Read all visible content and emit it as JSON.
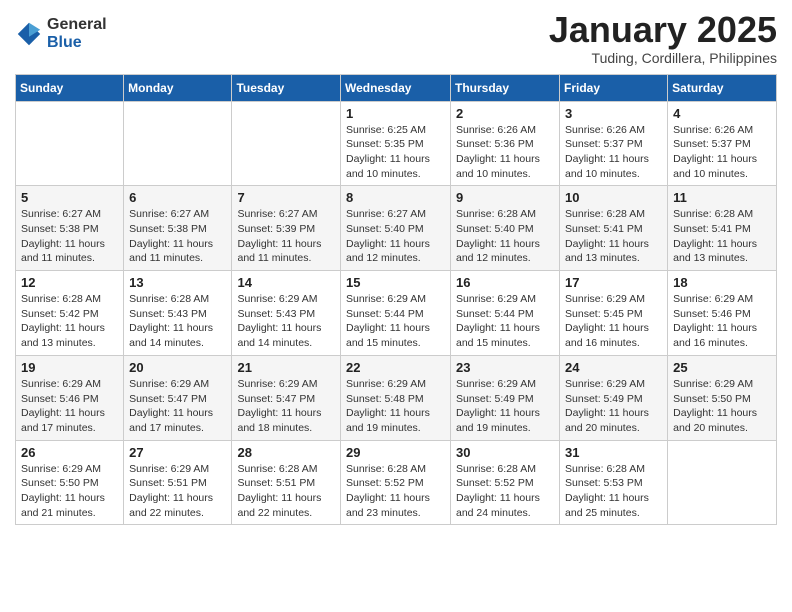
{
  "logo": {
    "general": "General",
    "blue": "Blue"
  },
  "title": {
    "month": "January 2025",
    "location": "Tuding, Cordillera, Philippines"
  },
  "days_header": [
    "Sunday",
    "Monday",
    "Tuesday",
    "Wednesday",
    "Thursday",
    "Friday",
    "Saturday"
  ],
  "weeks": [
    [
      {
        "day": "",
        "info": ""
      },
      {
        "day": "",
        "info": ""
      },
      {
        "day": "",
        "info": ""
      },
      {
        "day": "1",
        "info": "Sunrise: 6:25 AM\nSunset: 5:35 PM\nDaylight: 11 hours and 10 minutes."
      },
      {
        "day": "2",
        "info": "Sunrise: 6:26 AM\nSunset: 5:36 PM\nDaylight: 11 hours and 10 minutes."
      },
      {
        "day": "3",
        "info": "Sunrise: 6:26 AM\nSunset: 5:37 PM\nDaylight: 11 hours and 10 minutes."
      },
      {
        "day": "4",
        "info": "Sunrise: 6:26 AM\nSunset: 5:37 PM\nDaylight: 11 hours and 10 minutes."
      }
    ],
    [
      {
        "day": "5",
        "info": "Sunrise: 6:27 AM\nSunset: 5:38 PM\nDaylight: 11 hours and 11 minutes."
      },
      {
        "day": "6",
        "info": "Sunrise: 6:27 AM\nSunset: 5:38 PM\nDaylight: 11 hours and 11 minutes."
      },
      {
        "day": "7",
        "info": "Sunrise: 6:27 AM\nSunset: 5:39 PM\nDaylight: 11 hours and 11 minutes."
      },
      {
        "day": "8",
        "info": "Sunrise: 6:27 AM\nSunset: 5:40 PM\nDaylight: 11 hours and 12 minutes."
      },
      {
        "day": "9",
        "info": "Sunrise: 6:28 AM\nSunset: 5:40 PM\nDaylight: 11 hours and 12 minutes."
      },
      {
        "day": "10",
        "info": "Sunrise: 6:28 AM\nSunset: 5:41 PM\nDaylight: 11 hours and 13 minutes."
      },
      {
        "day": "11",
        "info": "Sunrise: 6:28 AM\nSunset: 5:41 PM\nDaylight: 11 hours and 13 minutes."
      }
    ],
    [
      {
        "day": "12",
        "info": "Sunrise: 6:28 AM\nSunset: 5:42 PM\nDaylight: 11 hours and 13 minutes."
      },
      {
        "day": "13",
        "info": "Sunrise: 6:28 AM\nSunset: 5:43 PM\nDaylight: 11 hours and 14 minutes."
      },
      {
        "day": "14",
        "info": "Sunrise: 6:29 AM\nSunset: 5:43 PM\nDaylight: 11 hours and 14 minutes."
      },
      {
        "day": "15",
        "info": "Sunrise: 6:29 AM\nSunset: 5:44 PM\nDaylight: 11 hours and 15 minutes."
      },
      {
        "day": "16",
        "info": "Sunrise: 6:29 AM\nSunset: 5:44 PM\nDaylight: 11 hours and 15 minutes."
      },
      {
        "day": "17",
        "info": "Sunrise: 6:29 AM\nSunset: 5:45 PM\nDaylight: 11 hours and 16 minutes."
      },
      {
        "day": "18",
        "info": "Sunrise: 6:29 AM\nSunset: 5:46 PM\nDaylight: 11 hours and 16 minutes."
      }
    ],
    [
      {
        "day": "19",
        "info": "Sunrise: 6:29 AM\nSunset: 5:46 PM\nDaylight: 11 hours and 17 minutes."
      },
      {
        "day": "20",
        "info": "Sunrise: 6:29 AM\nSunset: 5:47 PM\nDaylight: 11 hours and 17 minutes."
      },
      {
        "day": "21",
        "info": "Sunrise: 6:29 AM\nSunset: 5:47 PM\nDaylight: 11 hours and 18 minutes."
      },
      {
        "day": "22",
        "info": "Sunrise: 6:29 AM\nSunset: 5:48 PM\nDaylight: 11 hours and 19 minutes."
      },
      {
        "day": "23",
        "info": "Sunrise: 6:29 AM\nSunset: 5:49 PM\nDaylight: 11 hours and 19 minutes."
      },
      {
        "day": "24",
        "info": "Sunrise: 6:29 AM\nSunset: 5:49 PM\nDaylight: 11 hours and 20 minutes."
      },
      {
        "day": "25",
        "info": "Sunrise: 6:29 AM\nSunset: 5:50 PM\nDaylight: 11 hours and 20 minutes."
      }
    ],
    [
      {
        "day": "26",
        "info": "Sunrise: 6:29 AM\nSunset: 5:50 PM\nDaylight: 11 hours and 21 minutes."
      },
      {
        "day": "27",
        "info": "Sunrise: 6:29 AM\nSunset: 5:51 PM\nDaylight: 11 hours and 22 minutes."
      },
      {
        "day": "28",
        "info": "Sunrise: 6:28 AM\nSunset: 5:51 PM\nDaylight: 11 hours and 22 minutes."
      },
      {
        "day": "29",
        "info": "Sunrise: 6:28 AM\nSunset: 5:52 PM\nDaylight: 11 hours and 23 minutes."
      },
      {
        "day": "30",
        "info": "Sunrise: 6:28 AM\nSunset: 5:52 PM\nDaylight: 11 hours and 24 minutes."
      },
      {
        "day": "31",
        "info": "Sunrise: 6:28 AM\nSunset: 5:53 PM\nDaylight: 11 hours and 25 minutes."
      },
      {
        "day": "",
        "info": ""
      }
    ]
  ]
}
